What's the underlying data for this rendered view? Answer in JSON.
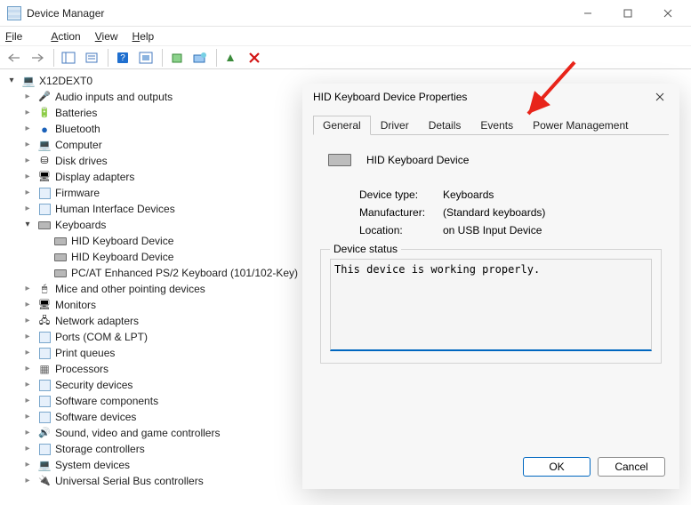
{
  "window": {
    "title": "Device Manager"
  },
  "menu": {
    "file": "File",
    "action": "Action",
    "view": "View",
    "help": "Help"
  },
  "tree": {
    "root": "X12DEXT0",
    "nodes": [
      {
        "label": "Audio inputs and outputs",
        "icon": "icon-audio"
      },
      {
        "label": "Batteries",
        "icon": "icon-bat"
      },
      {
        "label": "Bluetooth",
        "icon": "icon-bt"
      },
      {
        "label": "Computer",
        "icon": "icon-pc"
      },
      {
        "label": "Disk drives",
        "icon": "icon-disk"
      },
      {
        "label": "Display adapters",
        "icon": "icon-mon"
      },
      {
        "label": "Firmware",
        "icon": "icon-generic"
      },
      {
        "label": "Human Interface Devices",
        "icon": "icon-generic"
      },
      {
        "label": "Keyboards",
        "icon": "icon-kbd",
        "open": true,
        "children": [
          {
            "label": "HID Keyboard Device",
            "icon": "icon-kbd"
          },
          {
            "label": "HID Keyboard Device",
            "icon": "icon-kbd"
          },
          {
            "label": "PC/AT Enhanced PS/2 Keyboard (101/102-Key)",
            "icon": "icon-kbd"
          }
        ]
      },
      {
        "label": "Mice and other pointing devices",
        "icon": "icon-mouse"
      },
      {
        "label": "Monitors",
        "icon": "icon-mon"
      },
      {
        "label": "Network adapters",
        "icon": "icon-net"
      },
      {
        "label": "Ports (COM & LPT)",
        "icon": "icon-generic"
      },
      {
        "label": "Print queues",
        "icon": "icon-generic"
      },
      {
        "label": "Processors",
        "icon": "icon-proc"
      },
      {
        "label": "Security devices",
        "icon": "icon-generic"
      },
      {
        "label": "Software components",
        "icon": "icon-generic"
      },
      {
        "label": "Software devices",
        "icon": "icon-generic"
      },
      {
        "label": "Sound, video and game controllers",
        "icon": "icon-snd"
      },
      {
        "label": "Storage controllers",
        "icon": "icon-generic"
      },
      {
        "label": "System devices",
        "icon": "icon-pc"
      },
      {
        "label": "Universal Serial Bus controllers",
        "icon": "icon-usb"
      }
    ]
  },
  "dialog": {
    "title": "HID Keyboard Device Properties",
    "tabs": [
      "General",
      "Driver",
      "Details",
      "Events",
      "Power Management"
    ],
    "active_tab": 0,
    "device_name": "HID Keyboard Device",
    "props": {
      "type_k": "Device type:",
      "type_v": "Keyboards",
      "mfr_k": "Manufacturer:",
      "mfr_v": "(Standard keyboards)",
      "loc_k": "Location:",
      "loc_v": "on USB Input Device"
    },
    "status_legend": "Device status",
    "status_text": "This device is working properly.",
    "ok": "OK",
    "cancel": "Cancel"
  }
}
